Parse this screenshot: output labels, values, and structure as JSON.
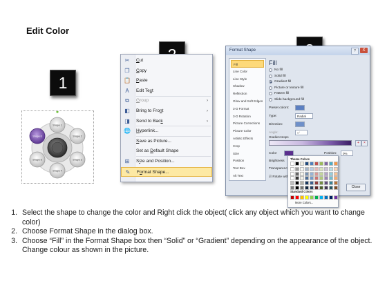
{
  "title": "Edit Color",
  "steps": [
    "1",
    "2",
    "3"
  ],
  "shapes": {
    "labels": [
      "Shape 1",
      "Shape 2",
      "Shape 3",
      "Shape 4",
      "Shape 5",
      "Shape 6"
    ],
    "colors": {
      "selected": "#7c57b0",
      "hub": "#444444",
      "ring": "#d9d9d9"
    }
  },
  "context_menu": {
    "items": [
      {
        "icon": "cut-icon",
        "glyph": "✂",
        "pre": "",
        "u": "C",
        "post": "ut"
      },
      {
        "icon": "copy-icon",
        "glyph": "❐",
        "pre": "",
        "u": "C",
        "post": "opy"
      },
      {
        "icon": "paste-icon",
        "glyph": "📋",
        "pre": "",
        "u": "P",
        "post": "aste"
      },
      {
        "icon": "edit-text-icon",
        "glyph": "A",
        "pre": "Edit Te",
        "u": "x",
        "post": "t"
      },
      {
        "icon": "group-icon",
        "glyph": "⧉",
        "pre": "",
        "u": "G",
        "post": "roup",
        "arrow": "›",
        "disabled": true
      },
      {
        "icon": "bring-front-icon",
        "glyph": "◧",
        "pre": "Bring to Fro",
        "u": "n",
        "post": "t",
        "arrow": "›"
      },
      {
        "icon": "send-back-icon",
        "glyph": "◨",
        "pre": "Send to Bac",
        "u": "k",
        "post": "",
        "arrow": "›"
      },
      {
        "icon": "hyperlink-icon",
        "glyph": "🌐",
        "pre": "",
        "u": "H",
        "post": "yperlink..."
      },
      {
        "icon": "",
        "glyph": "",
        "pre": "",
        "u": "S",
        "post": "ave as Picture..."
      },
      {
        "icon": "",
        "glyph": "",
        "pre": "Set as ",
        "u": "D",
        "post": "efault Shape"
      },
      {
        "icon": "size-position-icon",
        "glyph": "⊞",
        "pre": "S",
        "u": "i",
        "post": "ze and Position..."
      },
      {
        "icon": "format-shape-icon",
        "glyph": "✎",
        "pre": "F",
        "u": "o",
        "post": "rmat Shape...",
        "selected": true
      }
    ]
  },
  "dialog": {
    "title": "Format Shape",
    "help": "?",
    "close_x": "X",
    "categories": [
      "Fill",
      "Line Color",
      "Line Style",
      "Shadow",
      "Reflection",
      "Glow and Soft Edges",
      "3-D Format",
      "3-D Rotation",
      "Picture Corrections",
      "Picture Color",
      "Artistic Effects",
      "Crop",
      "Size",
      "Position",
      "Text Box",
      "Alt Text"
    ],
    "selected_category": "Fill",
    "fill_heading": "Fill",
    "fill_options": [
      {
        "label": "No fill",
        "on": false
      },
      {
        "label": "Solid fill",
        "on": false
      },
      {
        "label": "Gradient fill",
        "on": true
      },
      {
        "label": "Picture or texture fill",
        "on": false
      },
      {
        "label": "Pattern fill",
        "on": false
      },
      {
        "label": "Slide background fill",
        "on": false
      }
    ],
    "preset_colors_label": "Preset colors:",
    "type_label": "Type:",
    "type_value": "Radial",
    "direction_label": "Direction:",
    "angle_label": "Angle:",
    "angle_value": "0°",
    "gradient_stops_label": "Gradient stops",
    "color_label": "Color",
    "position_label": "Position:",
    "position_value": "0%",
    "brightness_label": "Brightness",
    "transparency_label": "Transparency",
    "rotate_label": "Rotate with shape",
    "close_label": "Close",
    "palette": {
      "theme_heading": "Theme Colors",
      "standard_heading": "Standard Colors",
      "more_label": "More Colors...",
      "theme_top": [
        "#ffffff",
        "#000000",
        "#eeece1",
        "#1f497d",
        "#4f81bd",
        "#c0504d",
        "#9bbb59",
        "#8064a2",
        "#4bacc6",
        "#f79646"
      ],
      "standard": [
        "#c00000",
        "#ff0000",
        "#ffc000",
        "#ffff00",
        "#92d050",
        "#00b050",
        "#00b0f0",
        "#0070c0",
        "#002060",
        "#7030a0"
      ]
    }
  },
  "instructions": [
    "Select the shape to change the color and Right click the object( click any object which you want to change color)",
    "Choose Format Shape in the dialog box.",
    "Choose “Fill” in the Format Shape box then “Solid” or “Gradient” depending on the appearance of the object. Change colour as shown in the picture."
  ]
}
